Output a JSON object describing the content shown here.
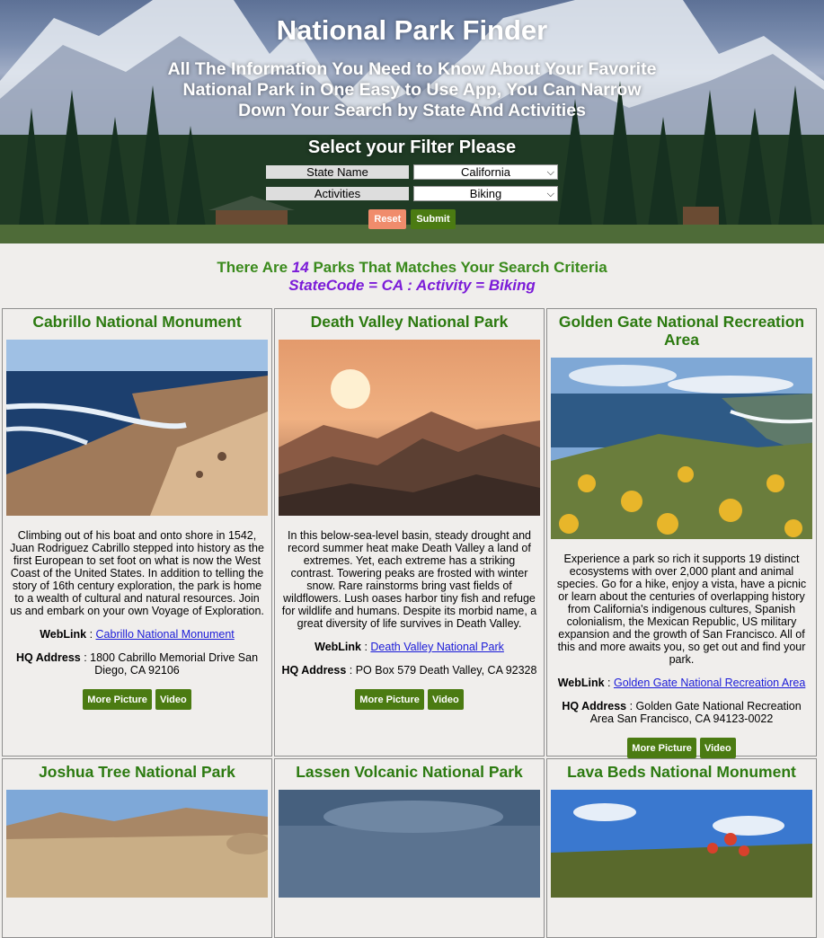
{
  "header": {
    "title": "National Park Finder",
    "subtitle": "All The Information You Need to Know About Your Favorite National Park in One Easy to Use App, You Can Narrow Down Your Search by State And Activities",
    "filter_title": "Select your Filter Please",
    "filters": {
      "state_label": "State Name",
      "state_value": "California",
      "activity_label": "Activities",
      "activity_value": "Biking"
    },
    "reset_label": "Reset",
    "submit_label": "Submit"
  },
  "result": {
    "prefix": "There Are",
    "count": "14",
    "suffix": "Parks That Matches Your Search Criteria",
    "criteria": "StateCode = CA : Activity = Biking"
  },
  "labels": {
    "weblink": "WebLink",
    "hq": "HQ Address",
    "more_picture": "More Picture",
    "video": "Video"
  },
  "parks": [
    {
      "name": "Cabrillo National Monument",
      "description": "Climbing out of his boat and onto shore in 1542, Juan Rodriguez Cabrillo stepped into history as the first European to set foot on what is now the West Coast of the United States. In addition to telling the story of 16th century exploration, the park is home to a wealth of cultural and natural resources. Join us and embark on your own Voyage of Exploration.",
      "weblink": "Cabrillo National Monument",
      "hq": "1800 Cabrillo Memorial Drive San Diego, CA 92106"
    },
    {
      "name": "Death Valley National Park",
      "description": "In this below-sea-level basin, steady drought and record summer heat make Death Valley a land of extremes. Yet, each extreme has a striking contrast. Towering peaks are frosted with winter snow. Rare rainstorms bring vast fields of wildflowers. Lush oases harbor tiny fish and refuge for wildlife and humans. Despite its morbid name, a great diversity of life survives in Death Valley.",
      "weblink": "Death Valley National Park",
      "hq": "PO Box 579 Death Valley, CA 92328"
    },
    {
      "name": "Golden Gate National Recreation Area",
      "description": "Experience a park so rich it supports 19 distinct ecosystems with over 2,000 plant and animal species. Go for a hike, enjoy a vista, have a picnic or learn about the centuries of overlapping history from California's indigenous cultures, Spanish colonialism, the Mexican Republic, US military expansion and the growth of San Francisco. All of this and more awaits you, so get out and find your park.",
      "weblink": "Golden Gate National Recreation Area",
      "hq": "Golden Gate National Recreation Area San Francisco, CA 94123-0022"
    },
    {
      "name": "Joshua Tree National Park"
    },
    {
      "name": "Lassen Volcanic National Park"
    },
    {
      "name": "Lava Beds National Monument"
    }
  ]
}
